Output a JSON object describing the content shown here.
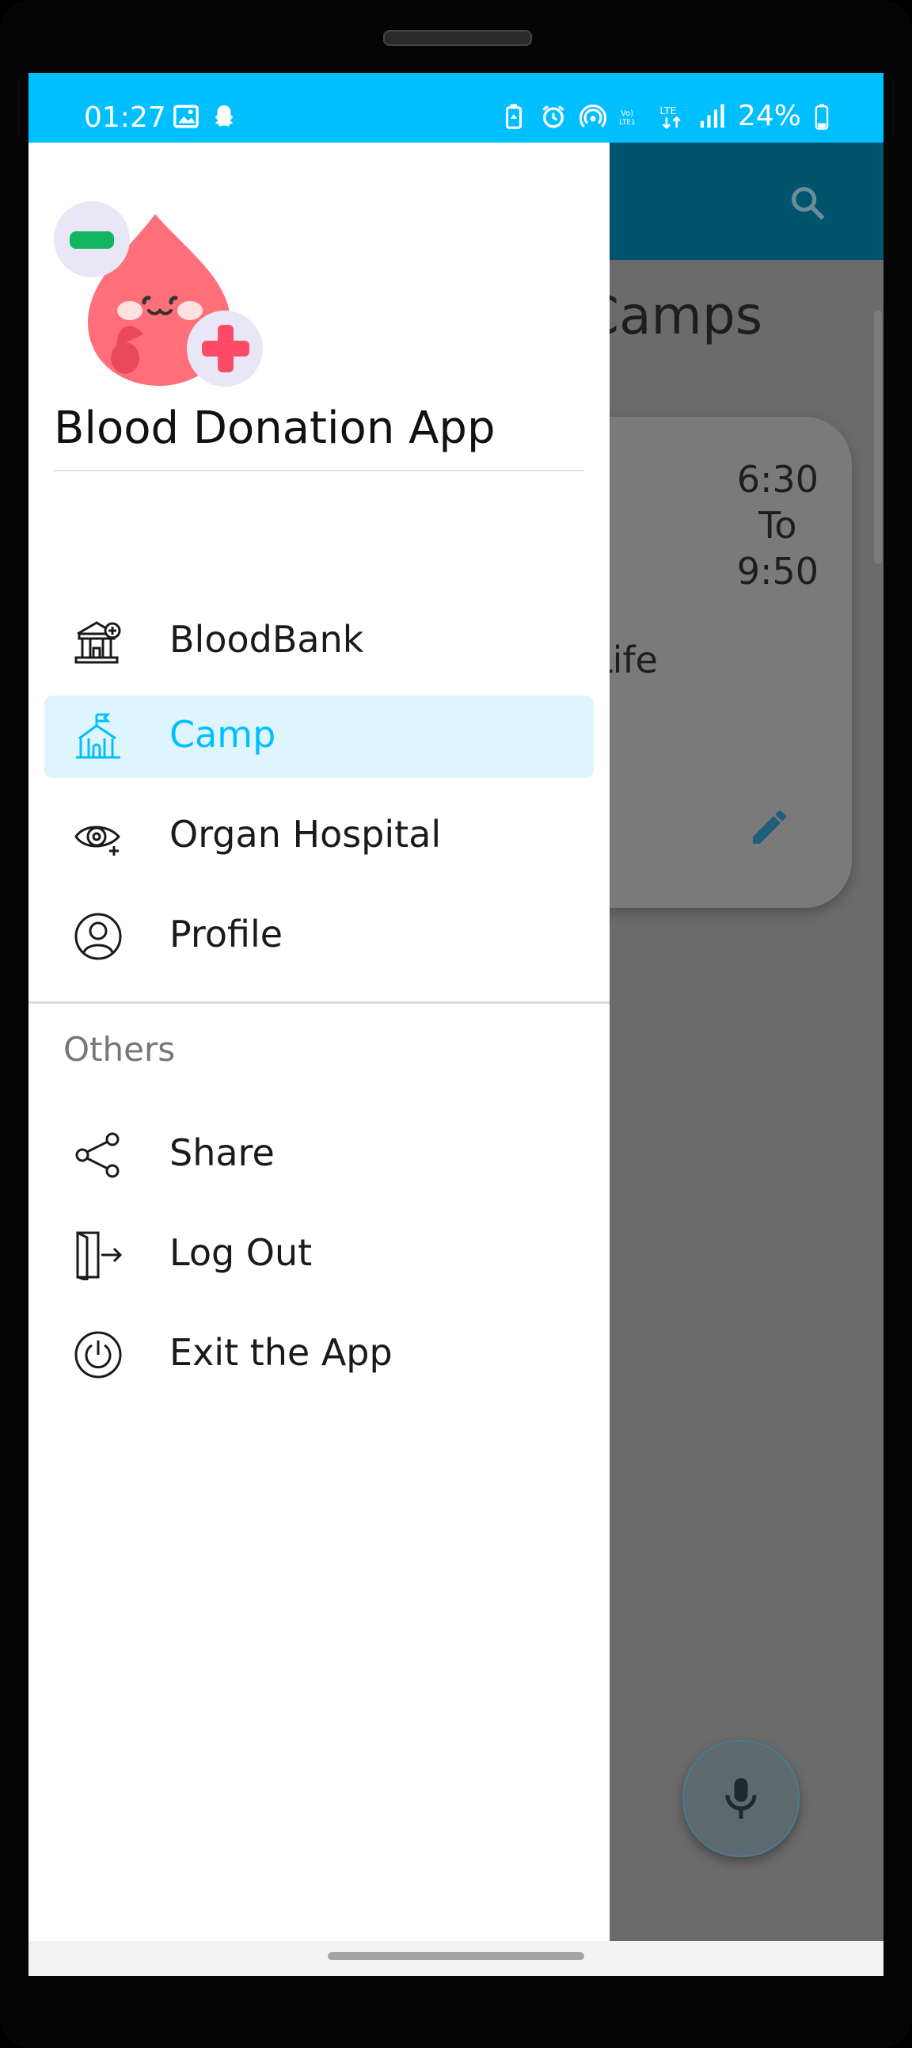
{
  "status_bar": {
    "time": "01:27",
    "battery": "24%",
    "left_icons": [
      "image-icon",
      "snapchat-icon"
    ],
    "right_icons": [
      "battery-saver-icon",
      "alarm-icon",
      "hotspot-icon",
      "volte-icon",
      "lte-icon",
      "signal-icon",
      "battery-icon"
    ],
    "background_color": "#00BFFF"
  },
  "background_app": {
    "page_title": "Camps",
    "camp_card": {
      "time_start": "6:30",
      "time_sep": "To",
      "time_end": "9:50",
      "text": "Life"
    },
    "toolbar_color": "#00546d"
  },
  "drawer": {
    "app_title": "Blood Donation App",
    "items": [
      {
        "label": "BloodBank",
        "icon": "bloodbank-building-icon",
        "active": false
      },
      {
        "label": "Camp",
        "icon": "camp-tent-icon",
        "active": true
      },
      {
        "label": "Organ Hospital",
        "icon": "organ-eye-icon",
        "active": false
      },
      {
        "label": "Profile",
        "icon": "profile-user-icon",
        "active": false
      }
    ],
    "section_header": "Others",
    "other_items": [
      {
        "label": "Share",
        "icon": "share-icon"
      },
      {
        "label": "Log Out",
        "icon": "logout-door-icon"
      },
      {
        "label": "Exit the App",
        "icon": "power-icon"
      }
    ],
    "active_color": "#00BFFF",
    "active_bg": "#dff5fd"
  }
}
